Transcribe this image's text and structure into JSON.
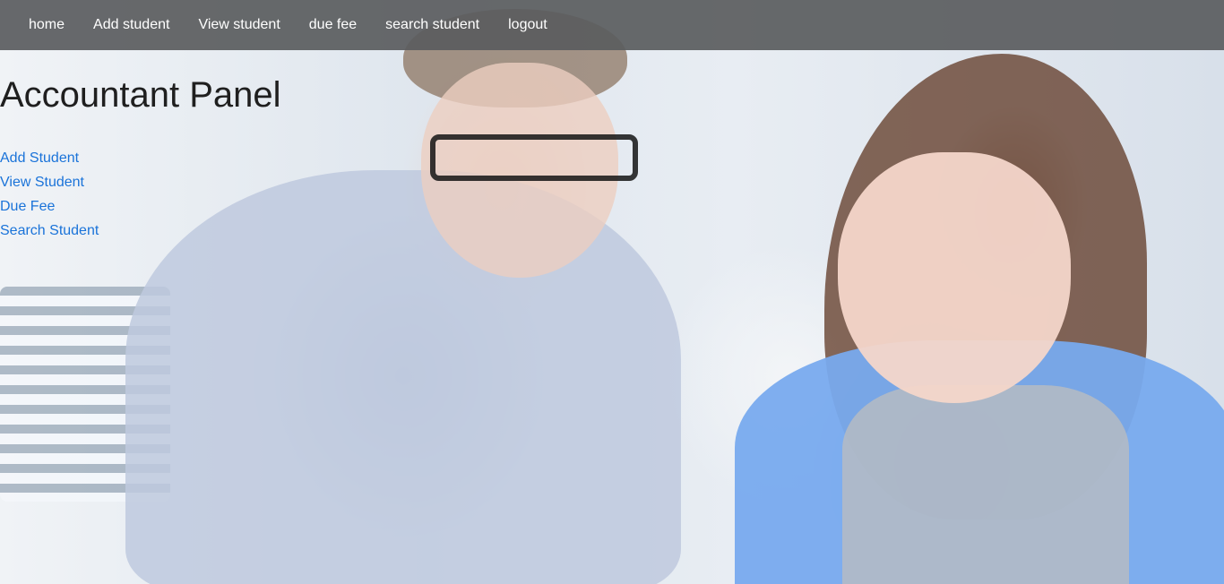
{
  "navbar": {
    "items": [
      {
        "label": "home"
      },
      {
        "label": "Add student"
      },
      {
        "label": "View student"
      },
      {
        "label": "due fee"
      },
      {
        "label": "search student"
      },
      {
        "label": "logout"
      }
    ]
  },
  "main": {
    "title": "Accountant Panel",
    "links": [
      {
        "label": "Add Student"
      },
      {
        "label": "View Student"
      },
      {
        "label": "Due Fee"
      },
      {
        "label": "Search Student"
      }
    ]
  },
  "colors": {
    "navbar_bg": "#5a5c5e",
    "link": "#1a73d9",
    "title": "#1f1f1f"
  }
}
